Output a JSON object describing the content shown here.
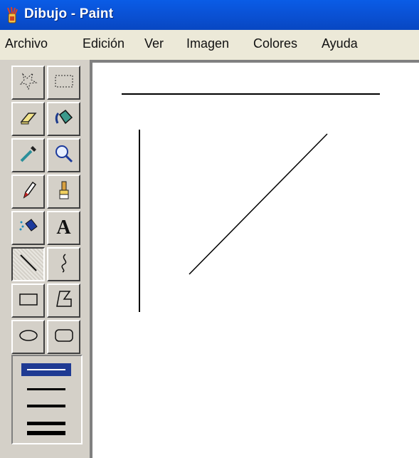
{
  "window": {
    "title": "Dibujo - Paint",
    "title_bar_color": "#0a5ce6"
  },
  "menu": {
    "items": [
      "Archivo",
      "Edición",
      "Ver",
      "Imagen",
      "Colores",
      "Ayuda"
    ]
  },
  "toolbox": {
    "tools": [
      {
        "icon": "free-form-select-icon",
        "name": "Selección de forma libre"
      },
      {
        "icon": "rect-select-icon",
        "name": "Selección"
      },
      {
        "icon": "eraser-icon",
        "name": "Borrador"
      },
      {
        "icon": "fill-bucket-icon",
        "name": "Relleno con color"
      },
      {
        "icon": "color-picker-icon",
        "name": "Seleccionar color"
      },
      {
        "icon": "magnifier-icon",
        "name": "Ampliación"
      },
      {
        "icon": "pencil-icon",
        "name": "Lápiz"
      },
      {
        "icon": "brush-icon",
        "name": "Pincel"
      },
      {
        "icon": "airbrush-icon",
        "name": "Aerógrafo"
      },
      {
        "icon": "text-icon",
        "name": "Texto",
        "glyph": "A"
      },
      {
        "icon": "line-icon",
        "name": "Línea",
        "selected": true
      },
      {
        "icon": "curve-icon",
        "name": "Curva"
      },
      {
        "icon": "rectangle-icon",
        "name": "Rectángulo"
      },
      {
        "icon": "polygon-icon",
        "name": "Polígono"
      },
      {
        "icon": "ellipse-icon",
        "name": "Elipse"
      },
      {
        "icon": "rounded-rectangle-icon",
        "name": "Rectángulo redondeado"
      }
    ],
    "line_widths": {
      "options": [
        1,
        2,
        3,
        4
      ],
      "selected_index": 0,
      "selected_color": "#1f3a93"
    }
  },
  "canvas": {
    "background": "#ffffff",
    "stroke": "#000000",
    "drawn_lines": [
      "horizontal-line",
      "vertical-line",
      "diagonal-line"
    ]
  }
}
